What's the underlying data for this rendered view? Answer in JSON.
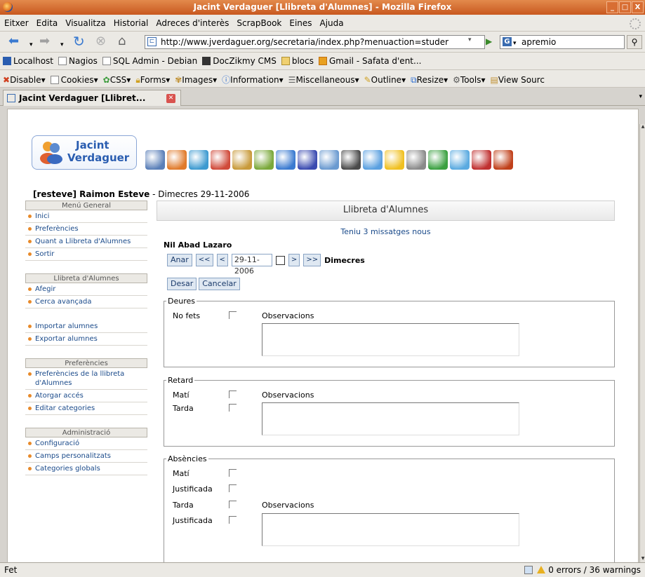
{
  "window": {
    "title": "Jacint Verdaguer [Llibreta d'Alumnes] - Mozilla Firefox",
    "controls": [
      "_",
      "□",
      "X"
    ]
  },
  "menubar": [
    "Eitxer",
    "Edita",
    "Visualitza",
    "Historial",
    "Adreces d'interès",
    "ScrapBook",
    "Eines",
    "Ajuda"
  ],
  "navbar": {
    "url": "http://www.jverdaguer.org/secretaria/index.php?menuaction=studer",
    "search": "apremio",
    "icons": [
      "back-icon",
      "forward-icon",
      "reload-icon",
      "stop-icon",
      "home-icon"
    ]
  },
  "bookmarks": [
    "Localhost",
    "Nagios",
    "SQL Admin - Debian",
    "DocZikmy CMS",
    "blocs",
    "Gmail - Safata d'ent..."
  ],
  "webdev": [
    "Disable▾",
    "Cookies▾",
    "CSS▾",
    "Forms▾",
    "Images▾",
    "Information▾",
    "Miscellaneous▾",
    "Outline▾",
    "Resize▾",
    "Tools▾",
    "View Sourc"
  ],
  "tab": {
    "label": "Jacint Verdaguer [Llibret..."
  },
  "logo": {
    "line1": "Jacint",
    "line2": "Verdaguer"
  },
  "app_icons": [
    {
      "name": "calculator-app-icon",
      "color": "#5a7fb8"
    },
    {
      "name": "home-app-icon",
      "color": "#e07a2a"
    },
    {
      "name": "calendar-app-icon",
      "color": "#3d9ad0"
    },
    {
      "name": "users-app-icon",
      "color": "#d04a3a"
    },
    {
      "name": "contacts-app-icon",
      "color": "#c89a3a"
    },
    {
      "name": "notes-app-icon",
      "color": "#7aa83a"
    },
    {
      "name": "globe-app-icon",
      "color": "#3a7ad0"
    },
    {
      "name": "database-app-icon",
      "color": "#3a4ab0"
    },
    {
      "name": "settings-app-icon",
      "color": "#6a9ad0"
    },
    {
      "name": "tree-app-icon",
      "color": "#4a4a4a"
    },
    {
      "name": "clock-app-icon",
      "color": "#5aa0e0"
    },
    {
      "name": "star-app-icon",
      "color": "#f0c020"
    },
    {
      "name": "docs-app-icon",
      "color": "#8a8a8a"
    },
    {
      "name": "chart-app-icon",
      "color": "#3aa040"
    },
    {
      "name": "chat-app-icon",
      "color": "#5aaae0"
    },
    {
      "name": "flag-app-icon",
      "color": "#c03030"
    },
    {
      "name": "logout-app-icon",
      "color": "#c0401a"
    }
  ],
  "user": {
    "login": "[resteve] Raimon Esteve",
    "date_text": " - Dimecres 29-11-2006"
  },
  "sidebar": [
    {
      "title": "Menú General",
      "items": [
        "Inici",
        "Preferències",
        "Quant a Llibreta d'Alumnes",
        "Sortir"
      ]
    },
    {
      "title": "Llibreta d'Alumnes",
      "items": [
        "Afegir",
        "Cerca avançada",
        "",
        "Importar alumnes",
        "Exportar alumnes"
      ]
    },
    {
      "title": "Preferències",
      "items": [
        "Preferències de la llibreta d'Alumnes",
        "Atorgar accés",
        "Editar categories"
      ]
    },
    {
      "title": "Administració",
      "items": [
        "Configuració",
        "Camps personalitzats",
        "Categories globals"
      ]
    }
  ],
  "main": {
    "title": "Llibreta d'Alumnes",
    "message": "Teniu 3 missatges nous",
    "student": "Nil Abad Lazaro",
    "nav": {
      "go": "Anar",
      "first": "<<",
      "prev": "<",
      "date": "29-11-2006",
      "next": ">",
      "last": ">>",
      "day": "Dimecres"
    },
    "save": "Desar",
    "cancel": "Cancelar",
    "deures": {
      "legend": "Deures",
      "rows": [
        "No fets"
      ],
      "obs": "Observacions"
    },
    "retard": {
      "legend": "Retard",
      "rows": [
        "Matí",
        "Tarda"
      ],
      "obs": "Observacions"
    },
    "absencies": {
      "legend": "Absències",
      "rows": [
        "Matí",
        "Justificada",
        "Tarda",
        "Justificada"
      ],
      "obs": "Observacions"
    }
  },
  "status": {
    "left": "Fet",
    "right": "0 errors / 36 warnings"
  }
}
